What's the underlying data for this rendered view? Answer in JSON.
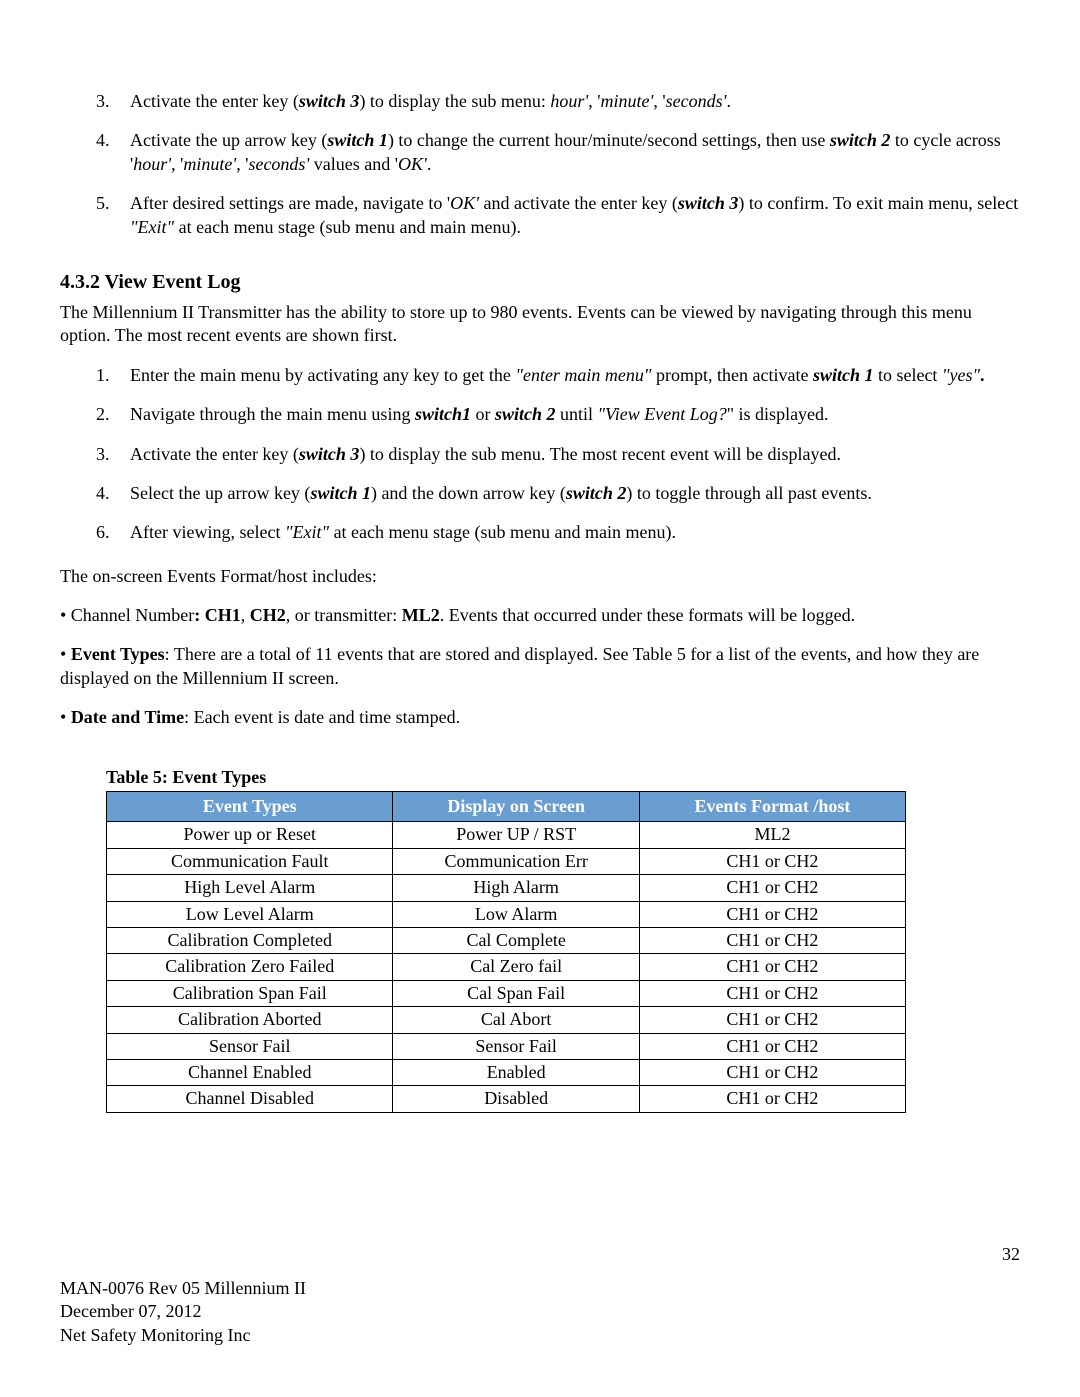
{
  "list_a": [
    {
      "num": "3.",
      "html": "Activate the enter key (<span class='bold italic'>switch 3</span>) to display the sub menu: <span class='italic'>hour'</span>, '<span class='italic'>minute'</span>, '<span class='italic'>seconds'</span>."
    },
    {
      "num": "4.",
      "html": "Activate the up arrow key (<span class='bold italic'>switch 1</span>) to change the current hour/minute/second settings, then use <span class='bold italic'>switch 2</span> to cycle across  '<span class='italic'>hour'</span>, '<span class='italic'>minute'</span>, '<span class='italic'>seconds'</span> values and '<span class='italic'>OK'</span>."
    },
    {
      "num": "5.",
      "html": "After desired settings are made, navigate to '<span class='italic'>OK'</span> and activate the enter key (<span class='bold italic'>switch 3</span>) to confirm. To exit main menu, select <span class='italic'>\"Exit\"</span> at each menu stage (sub menu and main menu)."
    }
  ],
  "section_heading": "4.3.2 View Event Log",
  "section_intro": "The Millennium II Transmitter has the ability to store up to 980 events. Events can be viewed by navigating through this menu option. The most recent events are shown first.",
  "list_b": [
    {
      "num": "1.",
      "html": "Enter the main menu by activating any key to get the <span class='italic'>\"enter main menu\"</span> prompt, then activate <span class='bold italic'>switch 1</span> to select <span class='italic'>\"yes\"</span><span class='bold'>.</span>"
    },
    {
      "num": "2.",
      "html": "Navigate through the main menu using <span class='bold italic'>switch1</span> or <span class='bold italic'>switch 2</span> until <span class='italic'>\"View Event Log?</span>\" is displayed."
    },
    {
      "num": "3.",
      "html": "Activate the enter key (<span class='bold italic'>switch 3</span>) to display the sub menu. The most recent event will be displayed."
    },
    {
      "num": "4.",
      "html": "Select the up arrow key (<span class='bold italic'>switch 1</span>) and the down arrow key (<span class='bold italic'>switch 2</span>) to toggle through all past events."
    },
    {
      "num": "6.",
      "html": "After viewing, select <span class='italic'>\"Exit\"</span> at each menu stage (sub menu and main menu)."
    }
  ],
  "para_format_intro": "The on-screen Events Format/host includes:",
  "bullets": [
    "• Channel Number<span class='bold'>: CH1</span>, <span class='bold'>CH2</span>, or transmitter: <span class='bold'>ML2</span>.  Events that occurred under these formats will be logged.",
    "• <span class='bold'>Event Types</span>: There are a total of 11 events that are stored and displayed. See Table 5 for a list of the events, and how they are displayed on the Millennium II screen.",
    "• <span class='bold'>Date and Time</span>: Each event is date and time stamped."
  ],
  "table": {
    "caption": "Table 5: Event Types",
    "headers": [
      "Event Types",
      "Display on Screen",
      "Events Format /host"
    ],
    "rows": [
      [
        "Power up or Reset",
        "Power UP / RST",
        "ML2"
      ],
      [
        "Communication Fault",
        "Communication Err",
        "CH1 or CH2"
      ],
      [
        "High Level Alarm",
        "High Alarm",
        "CH1 or CH2"
      ],
      [
        "Low Level Alarm",
        "Low Alarm",
        "CH1 or CH2"
      ],
      [
        "Calibration Completed",
        "Cal Complete",
        "CH1 or CH2"
      ],
      [
        "Calibration Zero Failed",
        "Cal Zero fail",
        "CH1 or CH2"
      ],
      [
        "Calibration Span Fail",
        "Cal Span Fail",
        "CH1 or CH2"
      ],
      [
        "Calibration Aborted",
        "Cal Abort",
        "CH1 or CH2"
      ],
      [
        "Sensor Fail",
        "Sensor Fail",
        "CH1 or CH2"
      ],
      [
        "Channel Enabled",
        "Enabled",
        "CH1 or CH2"
      ],
      [
        "Channel Disabled",
        "Disabled",
        "CH1 or CH2"
      ]
    ]
  },
  "footer": {
    "page": "32",
    "line1": "MAN-0076 Rev 05 Millennium II",
    "line2": "December 07, 2012",
    "line3": "Net Safety Monitoring Inc"
  }
}
